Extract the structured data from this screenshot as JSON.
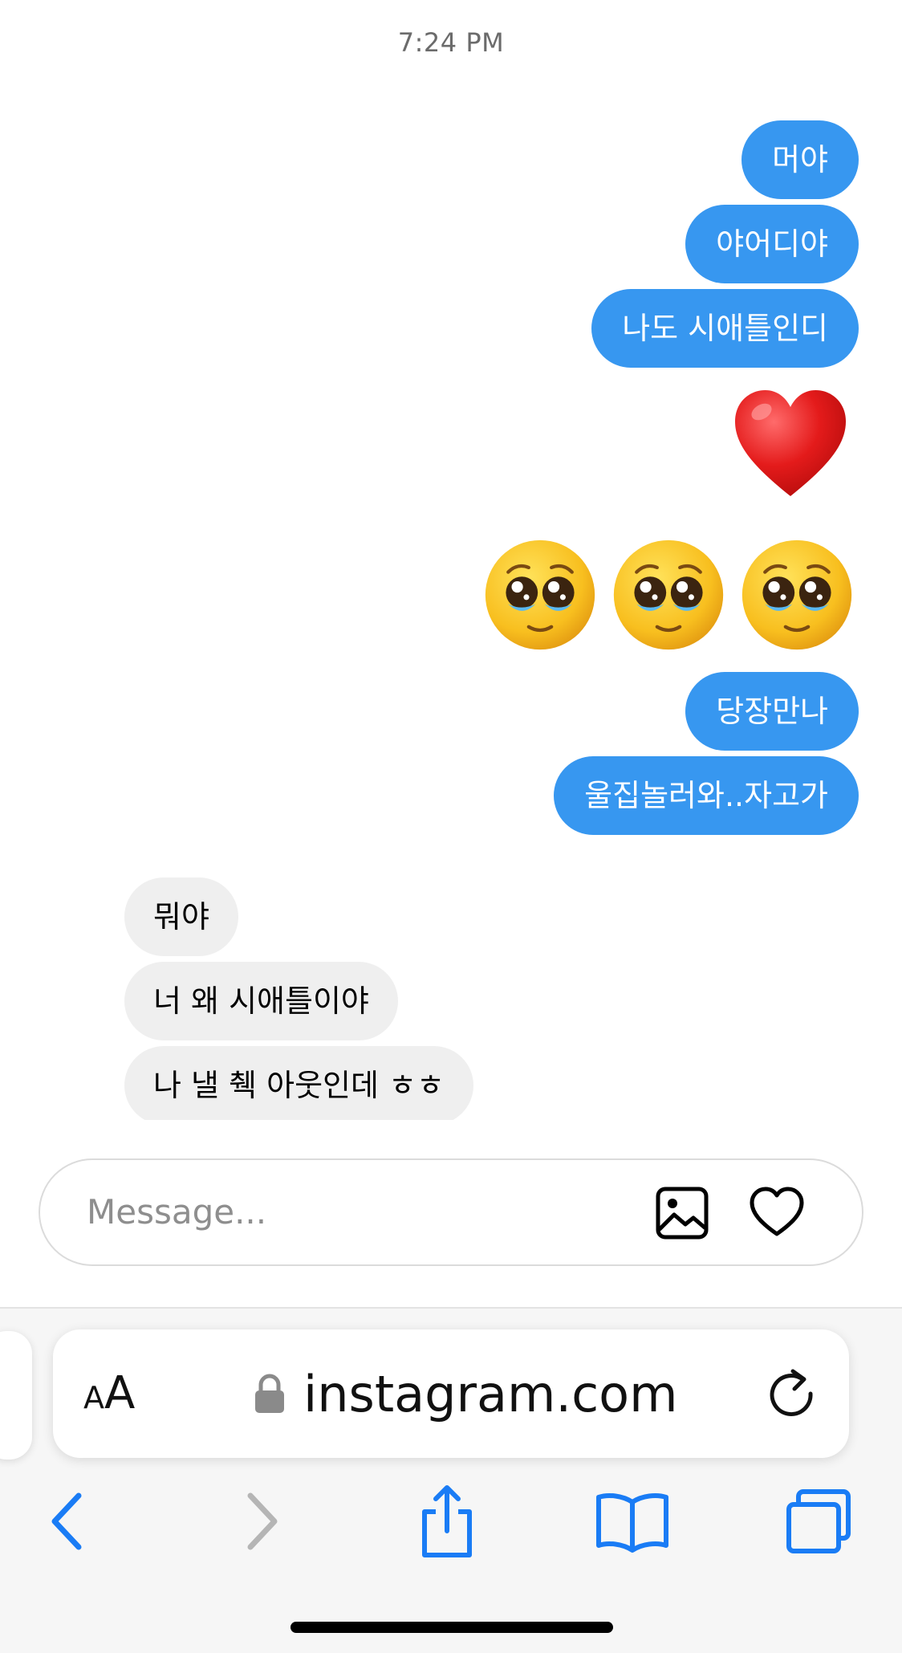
{
  "timestamp": "7:24 PM",
  "outgoing": [
    "머야",
    "야어디야",
    "나도 시애틀인디",
    "당장만나",
    "울집놀러와..자고가"
  ],
  "emojis": {
    "heart": "red-heart",
    "row": [
      "pleading-face",
      "pleading-face",
      "pleading-face"
    ]
  },
  "incoming": [
    "뭐야",
    "너 왜 시애틀이야",
    "나 낼 췍 아웃인데 ㅎㅎ"
  ],
  "composer": {
    "placeholder": "Message...",
    "icons": [
      "gallery-icon",
      "heart-outline-icon"
    ]
  },
  "safari": {
    "aa_small": "A",
    "aa_big": "A",
    "url": "instagram.com",
    "toolbar": [
      "back",
      "forward",
      "share",
      "bookmarks",
      "tabs"
    ]
  },
  "colors": {
    "outgoing_bubble": "#3797f0",
    "incoming_bubble": "#efefef",
    "safari_accent": "#1a7cf5",
    "disabled": "#b5b5b5"
  }
}
